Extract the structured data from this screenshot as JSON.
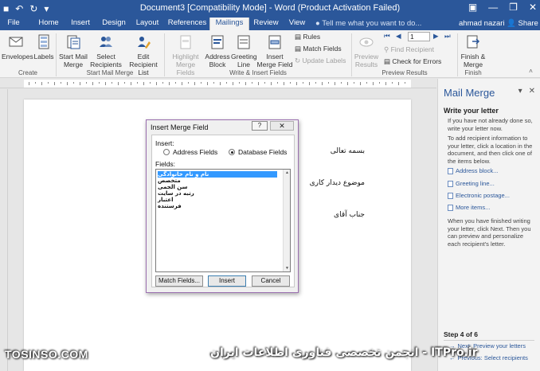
{
  "titlebar": {
    "title": "Document3 [Compatibility Mode] - Word (Product Activation Failed)",
    "minimize_glyph": "—",
    "restore_glyph": "❐",
    "close_glyph": "✕",
    "ribbon_display_glyph": "▣",
    "undo_glyph": "↶",
    "redo_glyph": "↻",
    "save_glyph": "■",
    "qat_more_glyph": "▾"
  },
  "tabs": [
    "File",
    "Home",
    "Insert",
    "Design",
    "Layout",
    "References",
    "Mailings",
    "Review",
    "View"
  ],
  "active_tab": "Mailings",
  "tell_me": "Tell me what you want to do...",
  "user": "ahmad nazari",
  "share": "Share",
  "ribbon": {
    "create": {
      "label": "Create",
      "envelopes": "Envelopes",
      "labels": "Labels"
    },
    "start": {
      "label": "Start Mail Merge",
      "start_mail_merge": "Start Mail Merge",
      "select_recipients": "Select Recipients",
      "edit_recipient_list": "Edit Recipient List"
    },
    "write": {
      "label": "Write & Insert Fields",
      "highlight": "Highlight Merge Fields",
      "address_block": "Address Block",
      "greeting_line": "Greeting Line",
      "insert_merge_field": "Insert Merge Field",
      "rules": "Rules",
      "match_fields": "Match Fields",
      "update_labels": "Update Labels"
    },
    "preview": {
      "label": "Preview Results",
      "preview_results": "Preview Results",
      "record": "1",
      "find_recipient": "Find Recipient",
      "check_errors": "Check for Errors"
    },
    "finish": {
      "label": "Finish",
      "finish_merge": "Finish & Merge"
    }
  },
  "document": {
    "line1": "بسمه تعالی",
    "line2": "موضوع دیدار کاری",
    "line3": "جناب آقای"
  },
  "dialog": {
    "title": "Insert Merge Field",
    "help": "?",
    "close": "✕",
    "insert_label": "Insert:",
    "address_fields": "Address Fields",
    "database_fields": "Database Fields",
    "selected_radio": "database_fields",
    "fields_label": "Fields:",
    "fields": [
      "نام و نام خانوادگی",
      "متخصص",
      "سن الجمی",
      "رتبه در سایت",
      "اعتبار",
      "فرستنده"
    ],
    "selected_field": 0,
    "match_fields": "Match Fields...",
    "insert": "Insert",
    "cancel": "Cancel"
  },
  "pane": {
    "title": "Mail Merge",
    "heading": "Write your letter",
    "p1": "If you have not already done so, write your letter now.",
    "p2": "To add recipient information to your letter, click a location in the document, and then click one of the items below.",
    "links": [
      "Address block...",
      "Greeting line...",
      "Electronic postage...",
      "More items..."
    ],
    "p3": "When you have finished writing your letter, click Next. Then you can preview and personalize each recipient's letter.",
    "step": "Step 4 of 6",
    "next": "Next: Preview your letters",
    "previous": "Previous: Select recipients"
  },
  "watermark": {
    "left": "TOSINSO.COM",
    "right": "ITPro.ir - انجمن تخصصی فناوری اطلاعات ایران"
  }
}
